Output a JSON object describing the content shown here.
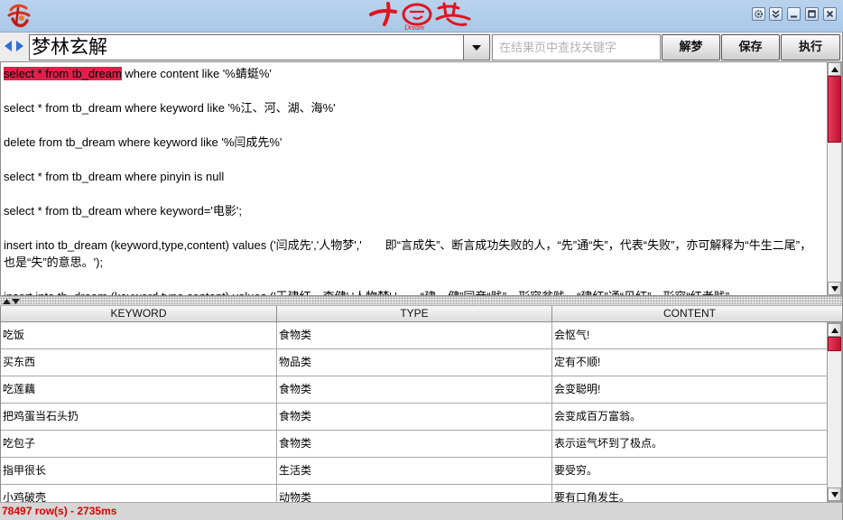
{
  "titlebar": {
    "logo_text": "Dream",
    "controls": [
      "gear-icon",
      "chevron-double-down-icon",
      "minimize-icon",
      "maximize-icon",
      "close-icon"
    ]
  },
  "toolbar": {
    "combo_value": "梦林玄解",
    "search_placeholder": "在结果页中查找关键字",
    "decode_label": "解梦",
    "save_label": "保存",
    "execute_label": "执行"
  },
  "editor": {
    "statements": [
      {
        "selected": "select * from tb_dream",
        "text": " where content like '%蜻蜓%'"
      },
      {
        "text": "select * from tb_dream where keyword like '%江、河、湖、海%'"
      },
      {
        "text": "delete from tb_dream where keyword like '%闫成先%'"
      },
      {
        "text": "select * from tb_dream where pinyin is null"
      },
      {
        "text": "select * from tb_dream where keyword='电影';"
      },
      {
        "text": "insert into tb_dream (keyword,type,content) values ('闫成先','人物梦','　　即“言成失”、断言成功失败的人，“先”通“失”，代表“失败”，亦可解释为“牛生二尾”，也是“失”的意思。');"
      },
      {
        "text": "insert into tb_dream (keyword,type,content) values ('王建红、李健','人物梦','　　“建、健”同音“贱”，形容贫贱，“建红”通“见红”，形容“红者贱”"
      }
    ]
  },
  "table": {
    "columns": [
      "KEYWORD",
      "TYPE",
      "CONTENT"
    ],
    "rows": [
      [
        "吃饭",
        "食物类",
        "会怄气!"
      ],
      [
        "买东西",
        "物品类",
        "定有不顺!"
      ],
      [
        "吃莲藕",
        "食物类",
        "会变聪明!"
      ],
      [
        "把鸡蛋当石头扔",
        "食物类",
        "会变成百万富翁。"
      ],
      [
        "吃包子",
        "食物类",
        "表示运气坏到了极点。"
      ],
      [
        "指甲很长",
        "生活类",
        "要受穷。"
      ],
      [
        "小鸡破壳",
        "动物类",
        "要有口角发生。"
      ]
    ]
  },
  "status": {
    "text": "78497 row(s) - 2735ms"
  },
  "colors": {
    "accent": "#e0204a",
    "titlebar": "#aac8e6",
    "status_text": "#e00000",
    "nav_arrow": "#2f6fd6"
  }
}
